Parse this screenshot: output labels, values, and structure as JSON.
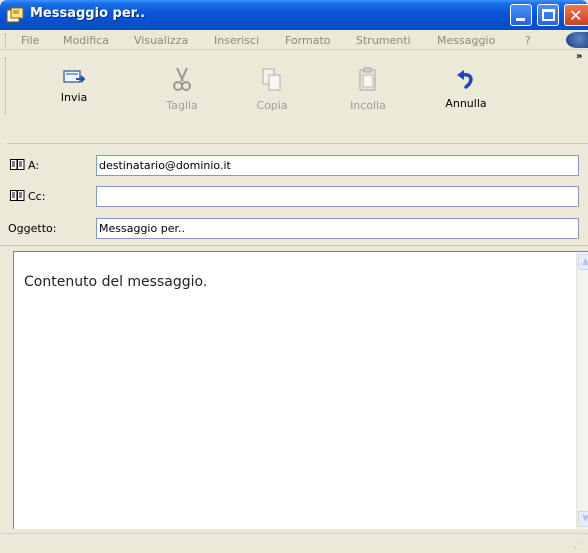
{
  "window": {
    "title": "Messaggio per..",
    "close_glyph": "✕"
  },
  "menu": {
    "items": [
      "File",
      "Modifica",
      "Visualizza",
      "Inserisci",
      "Formato",
      "Strumenti",
      "Messaggio",
      "?"
    ]
  },
  "toolbar": {
    "buttons": [
      {
        "label": "Invia",
        "icon": "send-icon",
        "enabled": true
      },
      {
        "label": "Taglia",
        "icon": "scissors-icon",
        "enabled": false
      },
      {
        "label": "Copia",
        "icon": "copy-icon",
        "enabled": false
      },
      {
        "label": "Incolla",
        "icon": "paste-icon",
        "enabled": false
      },
      {
        "label": "Annulla",
        "icon": "undo-icon",
        "enabled": true
      }
    ],
    "overflow": "»"
  },
  "header": {
    "to_label": "A:",
    "to_value": "destinatario@dominio.it",
    "cc_label": "Cc:",
    "cc_value": "",
    "subject_label": "Oggetto:",
    "subject_value": "Messaggio per.."
  },
  "message": {
    "body": "Contenuto del messaggio."
  },
  "colors": {
    "titlebar": "#0a58d8",
    "chrome": "#ece9d8",
    "input_border": "#7f9db9"
  }
}
